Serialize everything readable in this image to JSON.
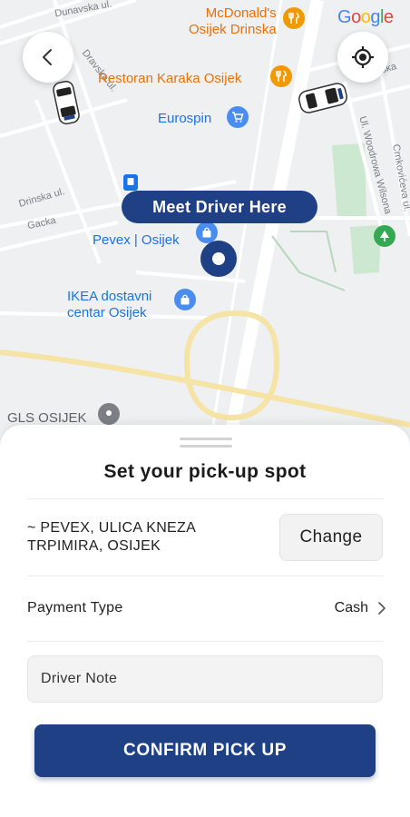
{
  "map": {
    "streets": [
      "Dunavska ul.",
      "Dravska ul.",
      "Drinska ul.",
      "Gacka",
      "Ul. Woodrowa Wilsona",
      "Crnkovićeva ul.",
      "nska"
    ],
    "pois": {
      "mcdonalds": "McDonald's\nOsijek Drinska",
      "restoran": "Restoran Karaka Osijek",
      "eurospin": "Eurospin",
      "pevex": "Pevex | Osijek",
      "ikea": "IKEA dostavni\ncentar Osijek",
      "gls": "GLS OSIJEK"
    },
    "meet_label": "Meet Driver Here",
    "google": [
      "G",
      "o",
      "o",
      "g",
      "l",
      "e"
    ],
    "google_colors": [
      "#4285f4",
      "#ea4335",
      "#fbbc05",
      "#4285f4",
      "#34a853",
      "#ea4335"
    ]
  },
  "controls": {
    "back_icon": "chevron-left-icon",
    "locate_icon": "crosshair-icon"
  },
  "sheet": {
    "title": "Set your pick-up spot",
    "address": "~ PEVEX, ULICA KNEZA TRPIMIRA, OSIJEK",
    "change_label": "Change",
    "payment_label": "Payment Type",
    "payment_value": "Cash",
    "driver_note_placeholder": "Driver Note",
    "confirm_label": "CONFIRM PICK UP"
  },
  "colors": {
    "brand": "#1f4085",
    "map_bg": "#eef0f1"
  }
}
